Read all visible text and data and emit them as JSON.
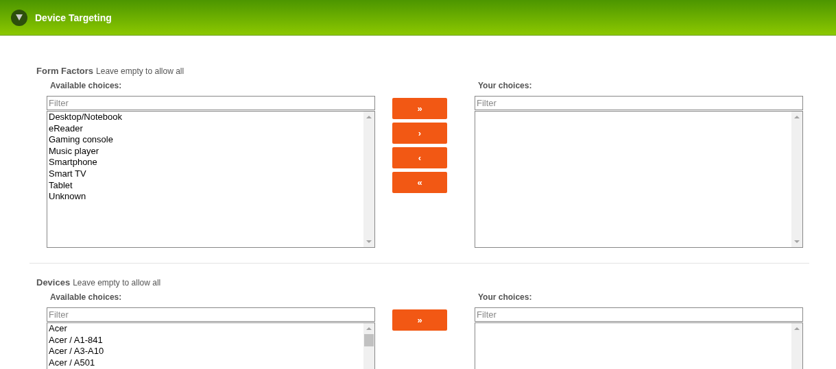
{
  "header": {
    "title": "Device Targeting"
  },
  "sections": [
    {
      "title": "Form Factors",
      "hint": "Leave empty to allow all",
      "available": {
        "label": "Available choices:",
        "placeholder": "Filter",
        "scrollable": false,
        "items": [
          "Desktop/Notebook",
          "eReader",
          "Gaming console",
          "Music player",
          "Smartphone",
          "Smart TV",
          "Tablet",
          "Unknown"
        ]
      },
      "buttons": [
        "»",
        "›",
        "‹",
        "«"
      ],
      "chosen": {
        "label": "Your choices:",
        "placeholder": "Filter",
        "scrollable": false
      }
    },
    {
      "title": "Devices",
      "hint": "Leave empty to allow all",
      "available": {
        "label": "Available choices:",
        "placeholder": "Filter",
        "scrollable": true,
        "items": [
          "Acer",
          "Acer / A1-841",
          "Acer / A3-A10",
          "Acer / A501"
        ]
      },
      "buttons": [
        "»"
      ],
      "chosen": {
        "label": "Your choices:",
        "placeholder": "Filter",
        "scrollable": false
      }
    }
  ]
}
